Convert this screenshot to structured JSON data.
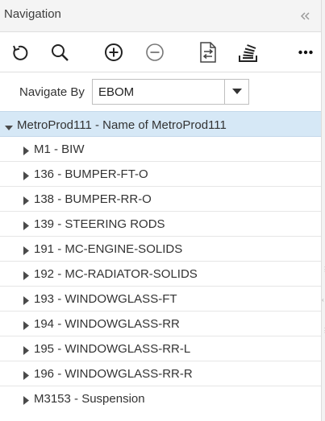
{
  "header": {
    "title": "Navigation",
    "collapse_icon": "double-chevron-left-icon"
  },
  "toolbar": {
    "buttons": [
      {
        "name": "refresh-button",
        "icon": "refresh-icon"
      },
      {
        "name": "search-button",
        "icon": "search-icon"
      },
      {
        "name": "expand-button",
        "icon": "plus-circle-icon"
      },
      {
        "name": "collapse-button",
        "icon": "minus-circle-icon"
      },
      {
        "name": "compare-button",
        "icon": "document-swap-icon"
      },
      {
        "name": "stack-button",
        "icon": "stack-icon"
      },
      {
        "name": "more-button",
        "icon": "more-horizontal-icon"
      }
    ]
  },
  "navigate_by": {
    "label": "Navigate By",
    "value": "EBOM"
  },
  "tree": {
    "root": "MetroProd111 - Name of MetroProd111",
    "children": [
      "M1 - BIW",
      "136 - BUMPER-FT-O",
      "138 - BUMPER-RR-O",
      "139 - STEERING RODS",
      "191 - MC-ENGINE-SOLIDS",
      "192 - MC-RADIATOR-SOLIDS",
      "193 - WINDOWGLASS-FT",
      "194 - WINDOWGLASS-RR",
      "195 - WINDOWGLASS-RR-L",
      "196 - WINDOWGLASS-RR-R",
      "M3153 - Suspension"
    ]
  },
  "colors": {
    "selected_row": "#d6e8f6",
    "header_bg": "#f4f4f4"
  }
}
